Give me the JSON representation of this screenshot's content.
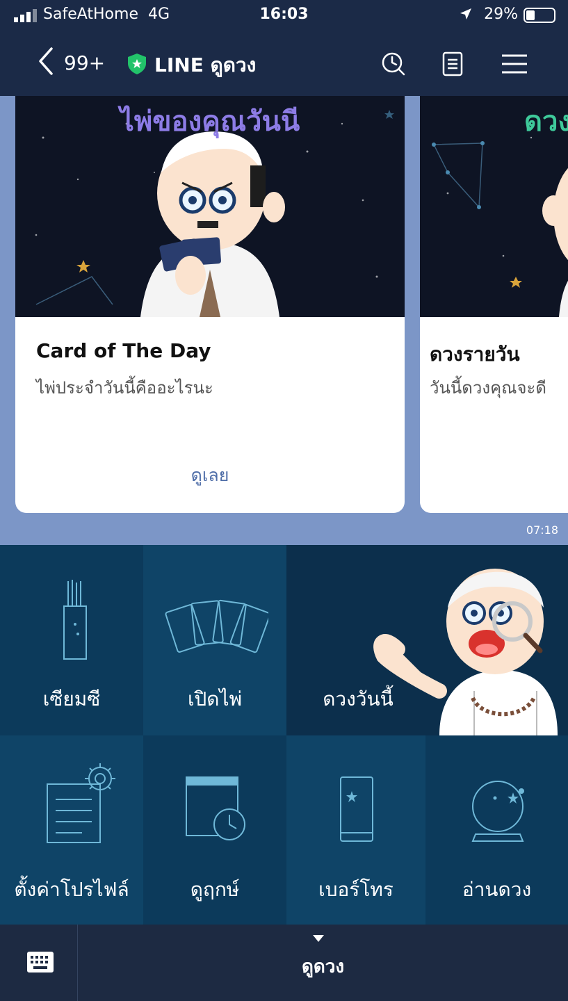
{
  "status_bar": {
    "carrier": "SafeAtHome",
    "network": "4G",
    "time": "16:03",
    "battery": "29%"
  },
  "header": {
    "unread": "99+",
    "title": "LINE ดูดวง",
    "icons": [
      "back-chevron-icon",
      "shield-icon",
      "clock-icon",
      "notes-icon",
      "menu-icon"
    ]
  },
  "chat": {
    "cards": [
      {
        "banner": "ไพ่ของคุณวันนี",
        "title": "Card of The Day",
        "subtitle": "ไพ่ประจำวันนี้คืออะไรนะ",
        "button": "ดูเลย"
      },
      {
        "banner": "ดวง",
        "title": "ดวงรายวัน",
        "subtitle": "วันนี้ดวงคุณจะดี",
        "button": ""
      }
    ],
    "timestamp": "07:18"
  },
  "menu": {
    "items": [
      {
        "label": "เซียมซี",
        "icon": "fortune-sticks-icon"
      },
      {
        "label": "เปิดไพ่",
        "icon": "tarot-cards-icon"
      },
      {
        "label": "ดวงวันนี้",
        "icon": "fortune-teller-character"
      },
      {
        "label": "ตั้งค่าโปรไฟล์",
        "icon": "profile-settings-icon"
      },
      {
        "label": "ดูฤกษ์",
        "icon": "calendar-clock-icon"
      },
      {
        "label": "เบอร์โทร",
        "icon": "phone-number-icon"
      },
      {
        "label": "อ่านดวง",
        "icon": "crystal-ball-icon"
      }
    ]
  },
  "bottom_bar": {
    "label": "ดูดวง"
  },
  "colors": {
    "header": "#1b2a47",
    "chat_bg": "#7c96c7",
    "menu_bg": "#0d3c5f",
    "banner": "#8d7ce6",
    "link": "#4f6ea8",
    "shield": "#22c36a"
  }
}
